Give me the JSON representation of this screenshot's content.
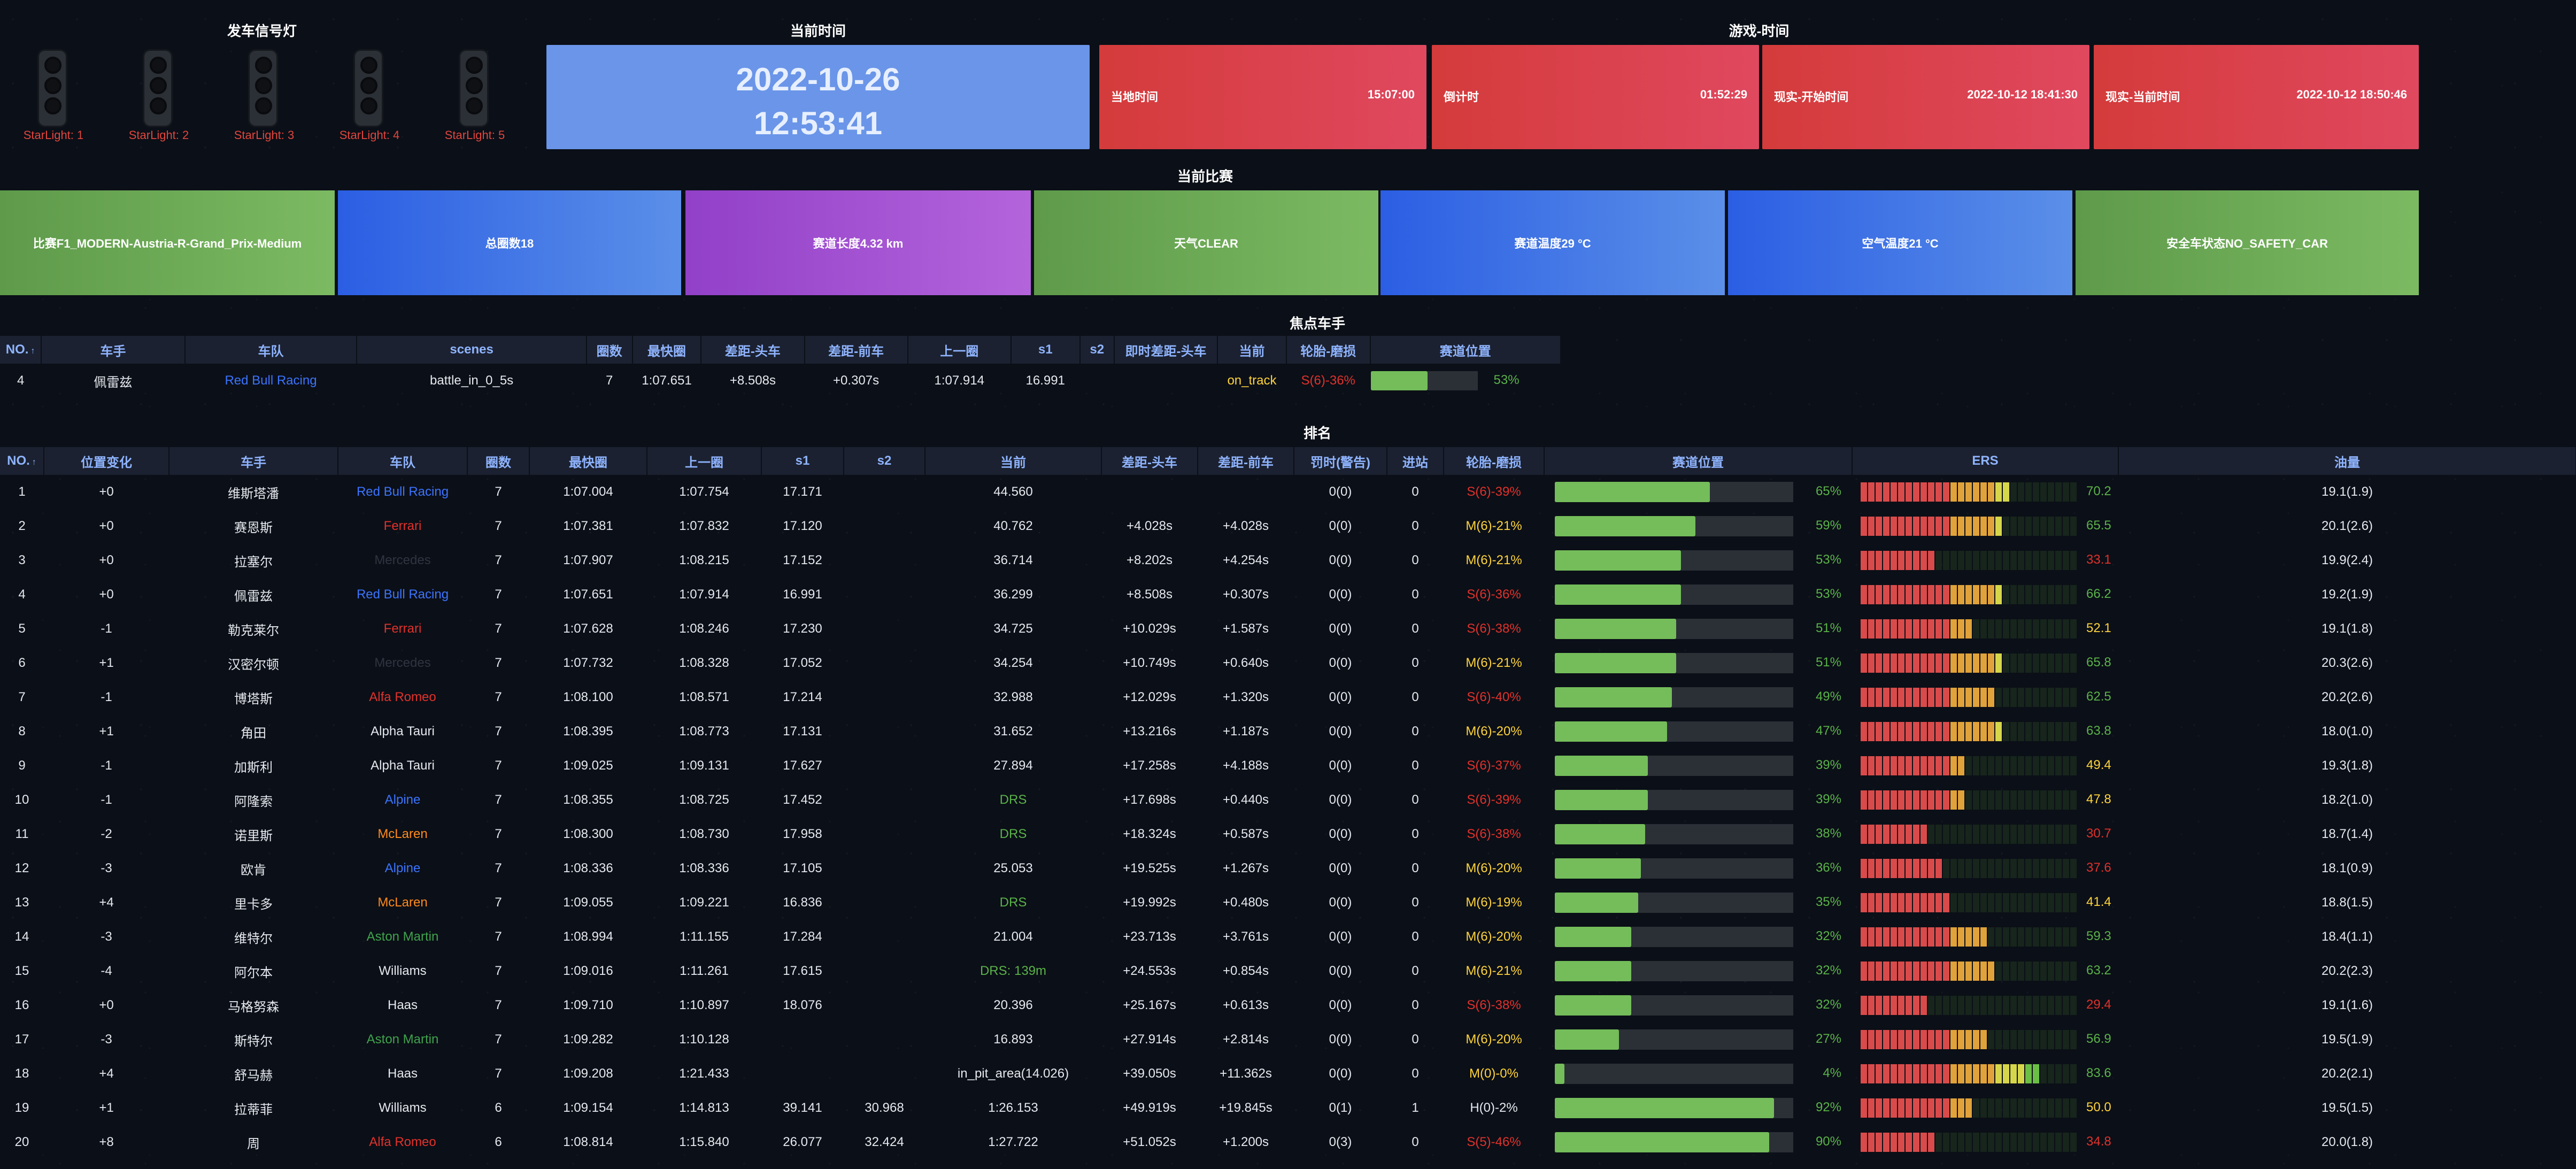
{
  "titles": {
    "start_lights": "发车信号灯",
    "current_time": "当前时间",
    "game_time": "游戏-时间",
    "current_race": "当前比赛",
    "focus_driver": "焦点车手",
    "ranking": "排名"
  },
  "lights": [
    "StarLight: 1",
    "StarLight: 2",
    "StarLight: 3",
    "StarLight: 4",
    "StarLight: 5"
  ],
  "now": {
    "date": "2022-10-26",
    "time": "12:53:41"
  },
  "game_time_cards": [
    {
      "label": "当地时间",
      "value": "15:07:00"
    },
    {
      "label": "倒计时",
      "value": "01:52:29"
    },
    {
      "label": "现实-开始时间",
      "value": "2022-10-12 18:41:30"
    },
    {
      "label": "现实-当前时间",
      "value": "2022-10-12 18:50:46"
    }
  ],
  "race_cards": [
    {
      "text": "比赛F1_MODERN-Austria-R-Grand_Prix-Medium",
      "style": "green"
    },
    {
      "text": "总圈数18",
      "style": "blue"
    },
    {
      "text": "赛道长度4.32 km",
      "style": "purple"
    },
    {
      "text": "天气CLEAR",
      "style": "green"
    },
    {
      "text": "赛道温度29 °C",
      "style": "blue"
    },
    {
      "text": "空气温度21 °C",
      "style": "blue"
    },
    {
      "text": "安全车状态NO_SAFETY_CAR",
      "style": "green"
    }
  ],
  "focus": {
    "headers": [
      "NO.",
      "车手",
      "车队",
      "scenes",
      "圈数",
      "最快圈",
      "差距-头车",
      "差距-前车",
      "上一圈",
      "s1",
      "s2",
      "即时差距-头车",
      "当前",
      "轮胎-磨损",
      "赛道位置"
    ],
    "sort_icon": "↑",
    "row": {
      "no": "4",
      "driver": "佩雷兹",
      "team": "Red Bull Racing",
      "team_cls": "t-rbr",
      "scenes": "battle_in_0_5s",
      "laps": "7",
      "fastest": "1:07.651",
      "gap_leader": "+8.508s",
      "gap_ahead": "+0.307s",
      "last": "1:07.914",
      "s1": "16.991",
      "s2": "",
      "live_gap": "",
      "status": "on_track",
      "tyre": "S(6)-36%",
      "track_pct": 53,
      "track_label": "53%"
    }
  },
  "ranking": {
    "headers": [
      "NO.",
      "位置变化",
      "车手",
      "车队",
      "圈数",
      "最快圈",
      "上一圈",
      "s1",
      "s2",
      "当前",
      "差距-头车",
      "差距-前车",
      "罚时(警告)",
      "进站",
      "轮胎-磨损",
      "赛道位置",
      "ERS",
      "油量"
    ],
    "sort_icon": "↑",
    "rows": [
      {
        "no": "1",
        "chg": "+0",
        "driver": "维斯塔潘",
        "team": "Red Bull Racing",
        "tc": "t-rbr",
        "laps": "7",
        "fast": "1:07.004",
        "last": "1:07.754",
        "s1": "17.171",
        "s2": "",
        "cur": "44.560",
        "curc": "w",
        "gl": "",
        "ga": "",
        "pen": "0(0)",
        "pit": "0",
        "tyre": "S(6)-39%",
        "tyc": "r",
        "trk": 65,
        "trkl": "65%",
        "ers": 70.2,
        "ersl": "70.2",
        "ersc": "g",
        "fuel": "19.1(1.9)"
      },
      {
        "no": "2",
        "chg": "+0",
        "driver": "赛恩斯",
        "team": "Ferrari",
        "tc": "t-fer",
        "laps": "7",
        "fast": "1:07.381",
        "last": "1:07.832",
        "s1": "17.120",
        "s2": "",
        "cur": "40.762",
        "curc": "w",
        "gl": "+4.028s",
        "ga": "+4.028s",
        "pen": "0(0)",
        "pit": "0",
        "tyre": "M(6)-21%",
        "tyc": "y",
        "trk": 59,
        "trkl": "59%",
        "ers": 65.5,
        "ersl": "65.5",
        "ersc": "g",
        "fuel": "20.1(2.6)"
      },
      {
        "no": "3",
        "chg": "+0",
        "driver": "拉塞尔",
        "team": "Mercedes",
        "tc": "t-mer",
        "laps": "7",
        "fast": "1:07.907",
        "last": "1:08.215",
        "s1": "17.152",
        "s2": "",
        "cur": "36.714",
        "curc": "w",
        "gl": "+8.202s",
        "ga": "+4.254s",
        "pen": "0(0)",
        "pit": "0",
        "tyre": "M(6)-21%",
        "tyc": "y",
        "trk": 53,
        "trkl": "53%",
        "ers": 33.1,
        "ersl": "33.1",
        "ersc": "r",
        "fuel": "19.9(2.4)"
      },
      {
        "no": "4",
        "chg": "+0",
        "driver": "佩雷兹",
        "team": "Red Bull Racing",
        "tc": "t-rbr",
        "laps": "7",
        "fast": "1:07.651",
        "last": "1:07.914",
        "s1": "16.991",
        "s2": "",
        "cur": "36.299",
        "curc": "w",
        "gl": "+8.508s",
        "ga": "+0.307s",
        "pen": "0(0)",
        "pit": "0",
        "tyre": "S(6)-36%",
        "tyc": "r",
        "trk": 53,
        "trkl": "53%",
        "ers": 66.2,
        "ersl": "66.2",
        "ersc": "g",
        "fuel": "19.2(1.9)"
      },
      {
        "no": "5",
        "chg": "-1",
        "driver": "勒克莱尔",
        "team": "Ferrari",
        "tc": "t-fer",
        "laps": "7",
        "fast": "1:07.628",
        "last": "1:08.246",
        "s1": "17.230",
        "s2": "",
        "cur": "34.725",
        "curc": "w",
        "gl": "+10.029s",
        "ga": "+1.587s",
        "pen": "0(0)",
        "pit": "0",
        "tyre": "S(6)-38%",
        "tyc": "r",
        "trk": 51,
        "trkl": "51%",
        "ers": 52.1,
        "ersl": "52.1",
        "ersc": "y",
        "fuel": "19.1(1.8)"
      },
      {
        "no": "6",
        "chg": "+1",
        "driver": "汉密尔顿",
        "team": "Mercedes",
        "tc": "t-mer",
        "laps": "7",
        "fast": "1:07.732",
        "last": "1:08.328",
        "s1": "17.052",
        "s2": "",
        "cur": "34.254",
        "curc": "w",
        "gl": "+10.749s",
        "ga": "+0.640s",
        "pen": "0(0)",
        "pit": "0",
        "tyre": "M(6)-21%",
        "tyc": "y",
        "trk": 51,
        "trkl": "51%",
        "ers": 65.8,
        "ersl": "65.8",
        "ersc": "g",
        "fuel": "20.3(2.6)"
      },
      {
        "no": "7",
        "chg": "-1",
        "driver": "博塔斯",
        "team": "Alfa Romeo",
        "tc": "t-alfa",
        "laps": "7",
        "fast": "1:08.100",
        "last": "1:08.571",
        "s1": "17.214",
        "s2": "",
        "cur": "32.988",
        "curc": "w",
        "gl": "+12.029s",
        "ga": "+1.320s",
        "pen": "0(0)",
        "pit": "0",
        "tyre": "S(6)-40%",
        "tyc": "r",
        "trk": 49,
        "trkl": "49%",
        "ers": 62.5,
        "ersl": "62.5",
        "ersc": "g",
        "fuel": "20.2(2.6)"
      },
      {
        "no": "8",
        "chg": "+1",
        "driver": "角田",
        "team": "Alpha Tauri",
        "tc": "t-at",
        "laps": "7",
        "fast": "1:08.395",
        "last": "1:08.773",
        "s1": "17.131",
        "s2": "",
        "cur": "31.652",
        "curc": "w",
        "gl": "+13.216s",
        "ga": "+1.187s",
        "pen": "0(0)",
        "pit": "0",
        "tyre": "M(6)-20%",
        "tyc": "y",
        "trk": 47,
        "trkl": "47%",
        "ers": 63.8,
        "ersl": "63.8",
        "ersc": "g",
        "fuel": "18.0(1.0)"
      },
      {
        "no": "9",
        "chg": "-1",
        "driver": "加斯利",
        "team": "Alpha Tauri",
        "tc": "t-at",
        "laps": "7",
        "fast": "1:09.025",
        "last": "1:09.131",
        "s1": "17.627",
        "s2": "",
        "cur": "27.894",
        "curc": "w",
        "gl": "+17.258s",
        "ga": "+4.188s",
        "pen": "0(0)",
        "pit": "0",
        "tyre": "S(6)-37%",
        "tyc": "r",
        "trk": 39,
        "trkl": "39%",
        "ers": 49.4,
        "ersl": "49.4",
        "ersc": "y",
        "fuel": "19.3(1.8)"
      },
      {
        "no": "10",
        "chg": "-1",
        "driver": "阿隆索",
        "team": "Alpine",
        "tc": "t-alp",
        "laps": "7",
        "fast": "1:08.355",
        "last": "1:08.725",
        "s1": "17.452",
        "s2": "",
        "cur": "DRS",
        "curc": "g",
        "gl": "+17.698s",
        "ga": "+0.440s",
        "pen": "0(0)",
        "pit": "0",
        "tyre": "S(6)-39%",
        "tyc": "r",
        "trk": 39,
        "trkl": "39%",
        "ers": 47.8,
        "ersl": "47.8",
        "ersc": "y",
        "fuel": "18.2(1.0)"
      },
      {
        "no": "11",
        "chg": "-2",
        "driver": "诺里斯",
        "team": "McLaren",
        "tc": "t-mcl",
        "laps": "7",
        "fast": "1:08.300",
        "last": "1:08.730",
        "s1": "17.958",
        "s2": "",
        "cur": "DRS",
        "curc": "g",
        "gl": "+18.324s",
        "ga": "+0.587s",
        "pen": "0(0)",
        "pit": "0",
        "tyre": "S(6)-38%",
        "tyc": "r",
        "trk": 38,
        "trkl": "38%",
        "ers": 30.7,
        "ersl": "30.7",
        "ersc": "r",
        "fuel": "18.7(1.4)"
      },
      {
        "no": "12",
        "chg": "-3",
        "driver": "欧肯",
        "team": "Alpine",
        "tc": "t-alp",
        "laps": "7",
        "fast": "1:08.336",
        "last": "1:08.336",
        "s1": "17.105",
        "s2": "",
        "cur": "25.053",
        "curc": "w",
        "gl": "+19.525s",
        "ga": "+1.267s",
        "pen": "0(0)",
        "pit": "0",
        "tyre": "M(6)-20%",
        "tyc": "y",
        "trk": 36,
        "trkl": "36%",
        "ers": 37.6,
        "ersl": "37.6",
        "ersc": "r",
        "fuel": "18.1(0.9)"
      },
      {
        "no": "13",
        "chg": "+4",
        "driver": "里卡多",
        "team": "McLaren",
        "tc": "t-mcl",
        "laps": "7",
        "fast": "1:09.055",
        "last": "1:09.221",
        "s1": "16.836",
        "s2": "",
        "cur": "DRS",
        "curc": "g",
        "gl": "+19.992s",
        "ga": "+0.480s",
        "pen": "0(0)",
        "pit": "0",
        "tyre": "M(6)-19%",
        "tyc": "y",
        "trk": 35,
        "trkl": "35%",
        "ers": 41.4,
        "ersl": "41.4",
        "ersc": "y",
        "fuel": "18.8(1.5)"
      },
      {
        "no": "14",
        "chg": "-3",
        "driver": "维特尔",
        "team": "Aston Martin",
        "tc": "t-am",
        "laps": "7",
        "fast": "1:08.994",
        "last": "1:11.155",
        "s1": "17.284",
        "s2": "",
        "cur": "21.004",
        "curc": "w",
        "gl": "+23.713s",
        "ga": "+3.761s",
        "pen": "0(0)",
        "pit": "0",
        "tyre": "M(6)-20%",
        "tyc": "y",
        "trk": 32,
        "trkl": "32%",
        "ers": 59.3,
        "ersl": "59.3",
        "ersc": "g",
        "fuel": "18.4(1.1)"
      },
      {
        "no": "15",
        "chg": "-4",
        "driver": "阿尔本",
        "team": "Williams",
        "tc": "t-wil",
        "laps": "7",
        "fast": "1:09.016",
        "last": "1:11.261",
        "s1": "17.615",
        "s2": "",
        "cur": "DRS: 139m",
        "curc": "g",
        "gl": "+24.553s",
        "ga": "+0.854s",
        "pen": "0(0)",
        "pit": "0",
        "tyre": "M(6)-21%",
        "tyc": "y",
        "trk": 32,
        "trkl": "32%",
        "ers": 63.2,
        "ersl": "63.2",
        "ersc": "g",
        "fuel": "20.2(2.3)"
      },
      {
        "no": "16",
        "chg": "+0",
        "driver": "马格努森",
        "team": "Haas",
        "tc": "t-haas",
        "laps": "7",
        "fast": "1:09.710",
        "last": "1:10.897",
        "s1": "18.076",
        "s2": "",
        "cur": "20.396",
        "curc": "w",
        "gl": "+25.167s",
        "ga": "+0.613s",
        "pen": "0(0)",
        "pit": "0",
        "tyre": "S(6)-38%",
        "tyc": "r",
        "trk": 32,
        "trkl": "32%",
        "ers": 29.4,
        "ersl": "29.4",
        "ersc": "r",
        "fuel": "19.1(1.6)"
      },
      {
        "no": "17",
        "chg": "-3",
        "driver": "斯特尔",
        "team": "Aston Martin",
        "tc": "t-am",
        "laps": "7",
        "fast": "1:09.282",
        "last": "1:10.128",
        "s1": "",
        "s2": "",
        "cur": "16.893",
        "curc": "w",
        "gl": "+27.914s",
        "ga": "+2.814s",
        "pen": "0(0)",
        "pit": "0",
        "tyre": "M(6)-20%",
        "tyc": "y",
        "trk": 27,
        "trkl": "27%",
        "ers": 56.9,
        "ersl": "56.9",
        "ersc": "g",
        "fuel": "19.5(1.9)"
      },
      {
        "no": "18",
        "chg": "+4",
        "driver": "舒马赫",
        "team": "Haas",
        "tc": "t-haas",
        "laps": "7",
        "fast": "1:09.208",
        "last": "1:21.433",
        "s1": "",
        "s2": "",
        "cur": "in_pit_area(14.026)",
        "curc": "w",
        "gl": "+39.050s",
        "ga": "+11.362s",
        "pen": "0(0)",
        "pit": "0",
        "tyre": "M(0)-0%",
        "tyc": "y",
        "trk": 4,
        "trkl": "4%",
        "ers": 83.6,
        "ersl": "83.6",
        "ersc": "g",
        "fuel": "20.2(2.1)"
      },
      {
        "no": "19",
        "chg": "+1",
        "driver": "拉蒂菲",
        "team": "Williams",
        "tc": "t-wil",
        "laps": "6",
        "fast": "1:09.154",
        "last": "1:14.813",
        "s1": "39.141",
        "s2": "30.968",
        "cur": "1:26.153",
        "curc": "w",
        "gl": "+49.919s",
        "ga": "+19.845s",
        "pen": "0(1)",
        "pit": "1",
        "tyre": "H(0)-2%",
        "tyc": "w",
        "trk": 92,
        "trkl": "92%",
        "ers": 50.0,
        "ersl": "50.0",
        "ersc": "y",
        "fuel": "19.5(1.5)"
      },
      {
        "no": "20",
        "chg": "+8",
        "driver": "周",
        "team": "Alfa Romeo",
        "tc": "t-alfa",
        "laps": "6",
        "fast": "1:08.814",
        "last": "1:15.840",
        "s1": "26.077",
        "s2": "32.424",
        "cur": "1:27.722",
        "curc": "w",
        "gl": "+51.052s",
        "ga": "+1.200s",
        "pen": "0(3)",
        "pit": "0",
        "tyre": "S(5)-46%",
        "tyc": "r",
        "trk": 90,
        "trkl": "90%",
        "ers": 34.8,
        "ersl": "34.8",
        "ersc": "r",
        "fuel": "20.0(1.8)"
      }
    ]
  }
}
